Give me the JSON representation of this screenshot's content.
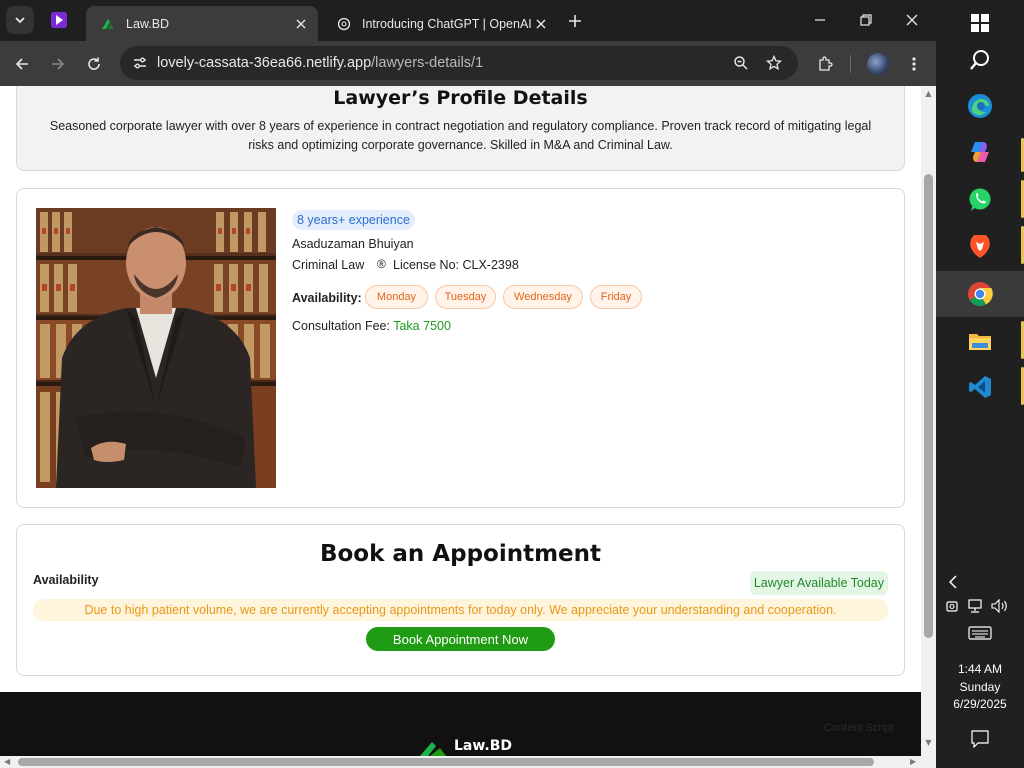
{
  "browser": {
    "tabs": [
      {
        "title": "Law.BD",
        "active": true
      },
      {
        "title": "Introducing ChatGPT | OpenAI",
        "active": false
      }
    ],
    "url_host": "lovely-cassata-36ea66.netlify.app",
    "url_path": "/lawyers-details/1"
  },
  "profile": {
    "heading": "Lawyer’s Profile Details",
    "summary": "Seasoned corporate lawyer with over 8 years of experience in contract negotiation and regulatory compliance. Proven track record of mitigating legal risks and optimizing corporate governance. Skilled in M&A and Criminal Law."
  },
  "lawyer": {
    "experience": "8 years+ experience",
    "name": "Asaduzaman Bhuiyan",
    "specialty": "Criminal Law",
    "license": "License No: CLX-2398",
    "availability_label": "Availability:",
    "days": [
      "Monday",
      "Tuesday",
      "Wednesday",
      "Friday"
    ],
    "fee_label": "Consultation Fee:",
    "fee_amount": "Taka 7500"
  },
  "booking": {
    "heading": "Book an Appointment",
    "availability_label": "Availability",
    "status_badge": "Lawyer Available Today",
    "notice": "Due to high patient volume, we are currently accepting appointments for today only. We appreciate your understanding and cooperation.",
    "button": "Book Appointment Now"
  },
  "footer": {
    "brand": "Law.BD",
    "faint_text": "Content Script"
  },
  "taskbar": {
    "apps": [
      "windows-start",
      "search",
      "edge",
      "copilot",
      "whatsapp",
      "brave",
      "chrome",
      "file-explorer",
      "vscode"
    ],
    "time": "1:44 AM",
    "day": "Sunday",
    "date": "6/29/2025"
  },
  "colors": {
    "accent_green": "#1f9c13",
    "badge_blue": "#2c6fd1",
    "day_orange": "#e1661b",
    "notice_amber": "#e8991a"
  }
}
